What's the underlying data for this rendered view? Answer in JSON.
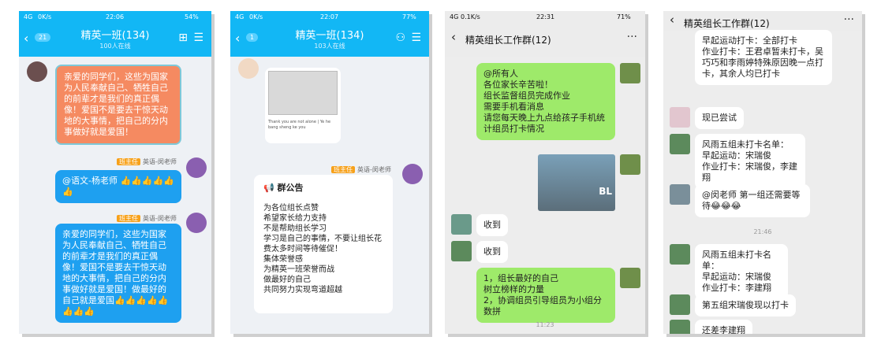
{
  "panel1": {
    "status": {
      "left": "4G",
      "speed": "0K/s",
      "time": "22:06",
      "battery": "54%"
    },
    "title": "精英一班(134)",
    "online": "100人在线",
    "back_badge": "21",
    "msg1": "亲爱的同学们，这些为国家为人民奉献自己、牺牲自己的前辈才是我们的真正偶像！爱国不是要去干惊天动地的大事情，把自己的分内事做好就是爱国！",
    "tag_role": "班主任",
    "tag_name": "英语-闵老师",
    "msg2": "@语文-杨老师 👍👍👍👍👍👍",
    "msg3": "亲爱的同学们，这些为国家为人民奉献自己、牺牲自己的前辈才是我们的真正偶像！爱国不是要去干惊天动地的大事情，把自己的分内事做好就是爱国！做最好的自己就是爱国👍👍👍👍👍👍👍👍"
  },
  "panel2": {
    "status": {
      "left": "4G",
      "speed": "0K/s",
      "time": "22:07",
      "battery": "77%"
    },
    "title": "精英一班(134)",
    "online": "103人在线",
    "back_badge": "1",
    "photo_caption": "Thank you are not alone | Ye he bang sheng ke you",
    "tag_role": "班主任",
    "tag_name": "英语-闵老师",
    "notice_title": "群公告",
    "notice_lines": [
      "为各位组长点赞",
      "希望家长给力支持",
      "不是帮助组长学习",
      "学习是自己的事情，不要让组长花费太多时间等待催促！",
      "集体荣誉感",
      "为精英一班荣誉而战",
      "做最好的自己",
      "共同努力实现弯道超越"
    ]
  },
  "panel3": {
    "status": {
      "left": "4G",
      "speed": "0.1K/s",
      "time": "22:31",
      "battery": "71%"
    },
    "title": "精英组长工作群(12)",
    "msg1": "@所有人\n各位家长辛苦啦！\n组长监督组员完成作业\n需要手机看消息\n请您每天晚上九点给孩子手机统计组员打卡情况",
    "photo_text": "BL",
    "msg2": "收到",
    "msg3": "收到",
    "msg4": "1，组长最好的自己\n树立榜样的力量\n2，协调组员引导组员为小组分数拼",
    "time": "11:23"
  },
  "panel4": {
    "title": "精英组长工作群(12)",
    "msg1": "早起运动打卡：全部打卡\n作业打卡：王君卓暂未打卡，吴巧巧和李雨婷特殊原因晚一点打卡，其余人均已打卡",
    "msg2": "现已尝试",
    "msg3": "风雨五组未打卡名单：\n早起运动：宋瑞俊\n作业打卡：宋瑞俊，李建翔",
    "msg4": "@闵老师  第一组还需要等待😂😂😂",
    "time": "21:46",
    "msg5": "风雨五组未打卡名单：\n早起运动：宋瑞俊\n作业打卡：李建翔",
    "msg6": "第五组宋瑞俊现以打卡",
    "msg7": "还差李建翔"
  }
}
